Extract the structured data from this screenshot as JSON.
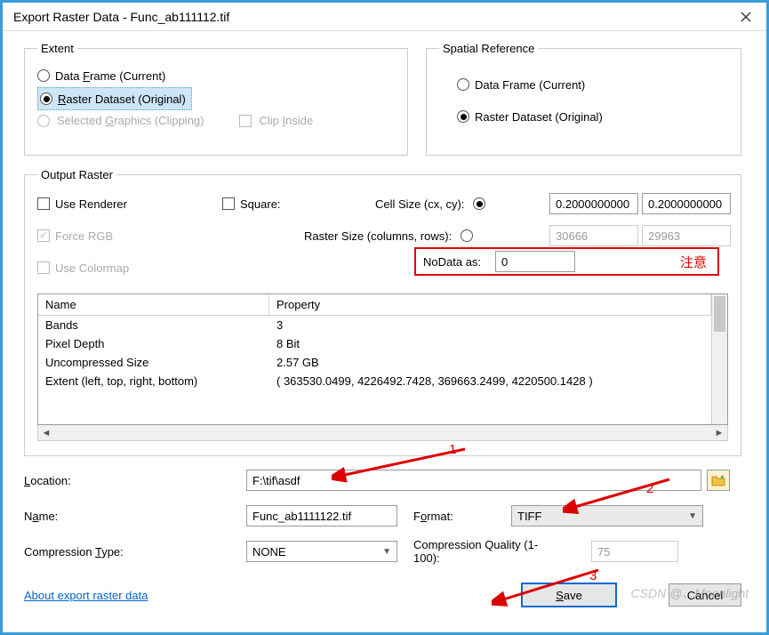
{
  "title": "Export Raster Data - Func_ab111112.tif",
  "extent": {
    "legend": "Extent",
    "opt1": "Data Frame (Current)",
    "opt2": "Raster Dataset (Original)",
    "opt3": "Selected Graphics (Clipping)",
    "clip_inside": "Clip Inside"
  },
  "spatial": {
    "legend": "Spatial Reference",
    "opt1": "Data Frame (Current)",
    "opt2": "Raster Dataset (Original)"
  },
  "output": {
    "legend": "Output Raster",
    "use_renderer": "Use Renderer",
    "square": "Square:",
    "cell_size_label": "Cell Size (cx, cy):",
    "cx": "0.2000000000",
    "cy": "0.2000000000",
    "force_rgb": "Force RGB",
    "raster_size_label": "Raster Size (columns, rows):",
    "cols": "30666",
    "rows": "29963",
    "use_colormap": "Use Colormap",
    "nodata_label": "NoData as:",
    "nodata_value": "0",
    "note": "注意"
  },
  "grid": {
    "col1": "Name",
    "col2": "Property",
    "rows": [
      {
        "name": "Bands",
        "prop": "3"
      },
      {
        "name": "Pixel Depth",
        "prop": "8 Bit"
      },
      {
        "name": "Uncompressed Size",
        "prop": "2.57 GB"
      },
      {
        "name": "Extent (left, top, right, bottom)",
        "prop": "( 363530.0499, 4226492.7428, 369663.2499, 4220500.1428 )"
      }
    ]
  },
  "form": {
    "location_label": "Location:",
    "location": "F:\\tif\\asdf",
    "name_label": "Name:",
    "name": "Func_ab1111122.tif",
    "format_label": "Format:",
    "format": "TIFF",
    "ctype_label": "Compression Type:",
    "ctype": "NONE",
    "cq_label": "Compression Quality (1-100):",
    "cq": "75"
  },
  "footer": {
    "link": "About export raster data",
    "save": "Save",
    "cancel": "Cancel"
  },
  "annotations": {
    "a1": "1",
    "a2": "2",
    "a3": "3"
  },
  "watermark": "CSDN @、Moonlight"
}
